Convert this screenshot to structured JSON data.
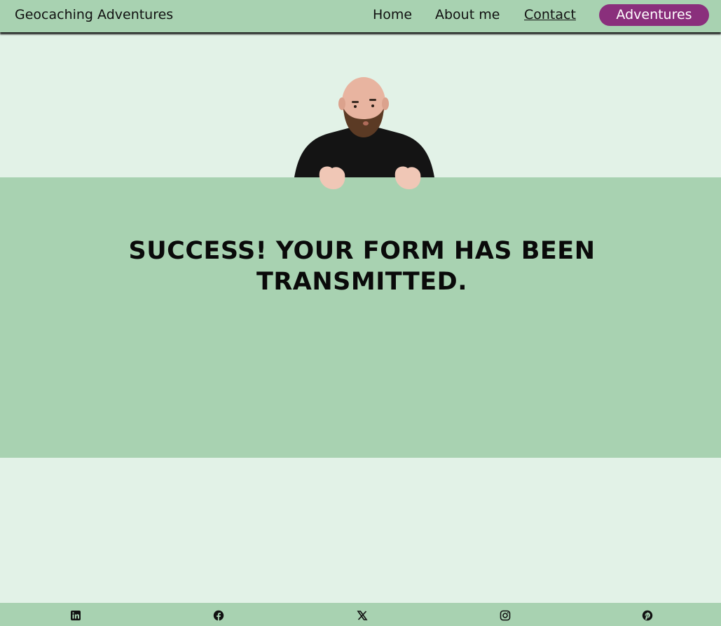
{
  "nav": {
    "brand": "Geocaching Adventures",
    "links": [
      "Home",
      "About me",
      "Contact"
    ],
    "cta": "Adventures",
    "cta_color": "#8a2f7c",
    "bar_color": "#a8d2b1"
  },
  "main": {
    "headline": "SUCCESS! YOUR FORM HAS BEEN TRANSMITTED.",
    "image": "peeking-man-photo"
  },
  "footer": {
    "icons": [
      "linkedin-icon",
      "facebook-icon",
      "x-icon",
      "instagram-icon",
      "pinterest-icon"
    ]
  }
}
